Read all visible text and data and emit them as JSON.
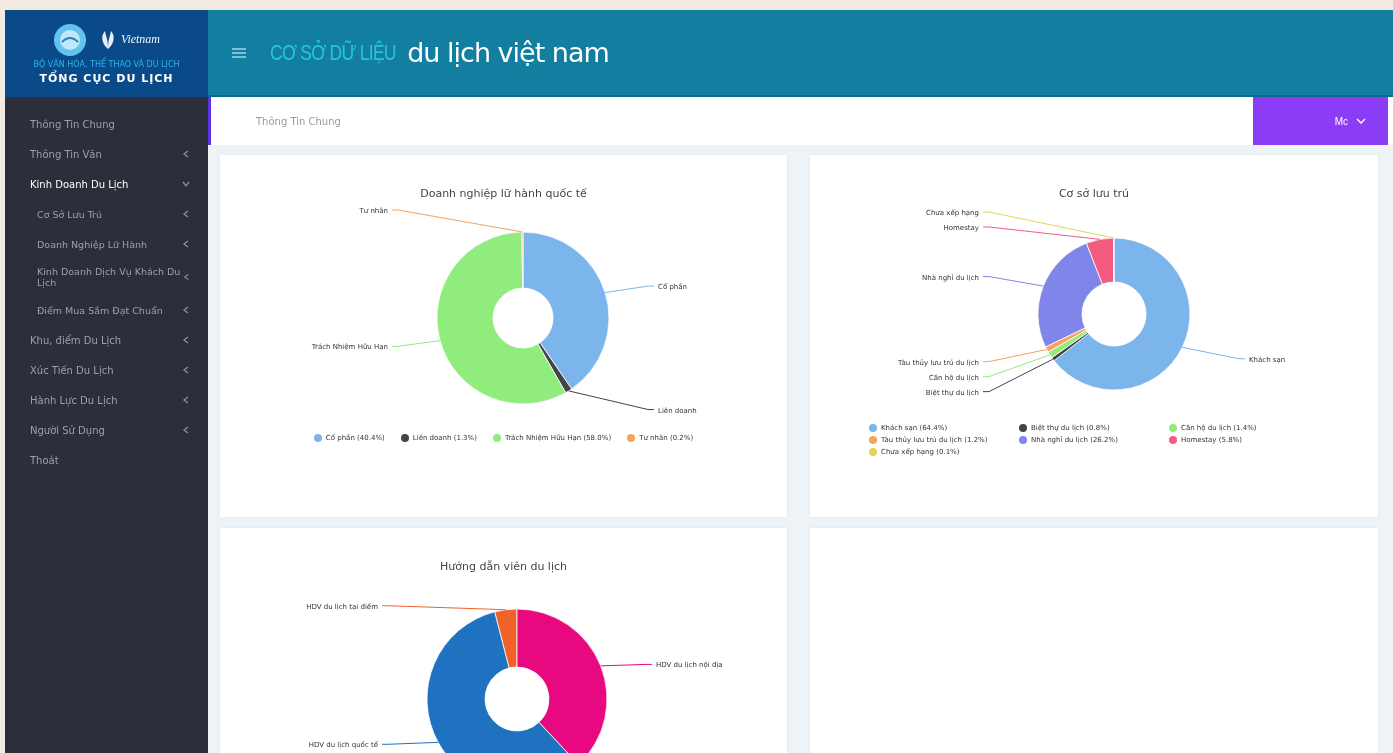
{
  "logo": {
    "brand": "Vietnam",
    "ministry": "BỘ VĂN HÓA, THỂ THAO VÀ DU LỊCH",
    "agency": "TỔNG CỤC DU LỊCH"
  },
  "header": {
    "title_part1": "CƠ SỞ DỮ LIỆU",
    "title_part2": "du lịch việt nam"
  },
  "sidebar": {
    "items": [
      {
        "label": "Thông Tin Chung",
        "selected": false
      },
      {
        "label": "Thông Tin Văn",
        "selected": false,
        "expanded": false
      },
      {
        "label": "Kinh Doanh Du Lịch",
        "selected": true,
        "expanded": true,
        "children": [
          {
            "label": "Cơ Sở Lưu Trú",
            "selected": false,
            "expanded": false
          },
          {
            "label": "Doanh Nghiệp Lữ Hành",
            "selected": false,
            "expanded": false
          },
          {
            "label": "Kinh Doanh Dịch Vụ Khách Du Lịch",
            "selected": false,
            "expanded": false
          },
          {
            "label": "Điểm Mua Sắm Đạt Chuẩn",
            "selected": false,
            "expanded": false
          }
        ]
      },
      {
        "label": "Khu, điểm Du Lịch",
        "selected": false,
        "expanded": false
      },
      {
        "label": "Xúc Tiến Du Lịch",
        "selected": false,
        "expanded": false
      },
      {
        "label": "Hành Lực Du Lịch",
        "selected": false,
        "expanded": false
      },
      {
        "label": "Người Sử Dụng",
        "selected": false,
        "expanded": false
      },
      {
        "label": "Thoát",
        "selected": false
      }
    ]
  },
  "breadcrumb": "Thông Tin Chung",
  "user_menu": {
    "label": "Mc"
  },
  "cards": [
    {
      "title": "Doanh nghiệp lữ hành quốc tế",
      "chart_data": {
        "type": "donut",
        "categories": [
          "Cổ phần",
          "Liên doanh",
          "Trách Nhiệm Hữu Hạn",
          "Tư nhân"
        ],
        "values": [
          40.4,
          1.3,
          58.0,
          0.2
        ]
      },
      "legend": [
        {
          "label": "Cổ phần (40.4%)",
          "color": "#7cb5ec"
        },
        {
          "label": "Liên doanh (1.3%)",
          "color": "#434348"
        },
        {
          "label": "Trách Nhiệm Hữu Hạn (58.0%)",
          "color": "#90ed7d"
        },
        {
          "label": "Tư nhân (0.2%)",
          "color": "#f7a35c"
        }
      ]
    },
    {
      "title": "Cơ sở lưu trú",
      "chart_data": {
        "type": "donut",
        "categories": [
          "Khách sạn",
          "Biệt thự du lịch",
          "Căn hộ du lịch",
          "Tàu thủy lưu trú du lịch",
          "Nhà nghỉ du lịch",
          "Homestay",
          "Chưa xếp hạng"
        ],
        "values": [
          64.4,
          0.8,
          1.4,
          1.2,
          26.2,
          5.8,
          0.1
        ]
      },
      "legend": [
        {
          "label": "Khách sạn (64.4%)",
          "color": "#7cb5ec"
        },
        {
          "label": "Biệt thự du lịch (0.8%)",
          "color": "#434348"
        },
        {
          "label": "Căn hộ du lịch (1.4%)",
          "color": "#90ed7d"
        },
        {
          "label": "Tàu thủy lưu trú du lịch (1.2%)",
          "color": "#f7a35c"
        },
        {
          "label": "Nhà nghỉ du lịch (26.2%)",
          "color": "#8085e9"
        },
        {
          "label": "Homestay (5.8%)",
          "color": "#f15c80"
        },
        {
          "label": "Chưa xếp hạng (0.1%)",
          "color": "#e4d354"
        }
      ]
    },
    {
      "title": "Hướng dẫn viên du lịch",
      "slices": [
        {
          "label": "HDV du lịch tại điểm",
          "color": "#f0622a"
        },
        {
          "label": "HDV du lịch nội địa",
          "color": "#e8087f"
        },
        {
          "label": "HDV du lịch quốc tế",
          "color": "#1f72c0"
        }
      ]
    }
  ]
}
